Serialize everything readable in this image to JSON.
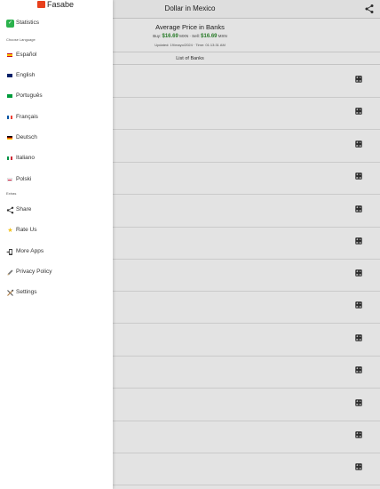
{
  "app": {
    "title": "Dollar in Mexico",
    "average": {
      "heading": "Average Price in Banks",
      "buy_label": "Buy:",
      "buy_value": "$16.69",
      "buy_unit": "MXN",
      "separator": "·",
      "sell_label": "Sell:",
      "sell_value": "$16.69",
      "sell_unit": "MXN",
      "updated": "Updated: 19/mayo/2024 · Time: 01:13:31 AM"
    },
    "list_title": "List of Banks"
  },
  "drawer": {
    "brand": "Fasabe",
    "statistics": "Statistics",
    "choose_language": "Choose Language",
    "languages": [
      "Español",
      "English",
      "Português",
      "Français",
      "Deutsch",
      "Italiano",
      "Polski"
    ],
    "extras_heading": "Extras",
    "share": "Share",
    "rate": "Rate Us",
    "more_apps": "More Apps",
    "privacy": "Privacy Policy",
    "settings": "Settings"
  },
  "icons": {
    "statistics": "statistics-icon",
    "share": "share-icon",
    "rate": "star-icon",
    "more_apps": "more-apps-icon",
    "privacy": "pencil-icon",
    "settings": "tools-icon",
    "calculator": "calculator-icon"
  },
  "colors": {
    "brand": "#e8401c",
    "price_green": "#2c8a2c",
    "statistics_green": "#2bb24c"
  }
}
